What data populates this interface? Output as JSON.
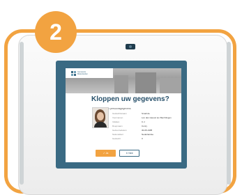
{
  "step": {
    "number": "2"
  },
  "screen": {
    "logo_text": [
      "Gemeente",
      "Molenlanden"
    ],
    "title": "Kloppen uw gegevens?",
    "subtitle": "Uw persoonsgegevens",
    "details": [
      {
        "label": "Geslachtsnaam",
        "value": "Smalt de"
      },
      {
        "label": "Voornamen",
        "value": "Lon den Heuvel ten Berchlingen"
      },
      {
        "label": "Initialen",
        "value": "C.J."
      },
      {
        "label": "Roepnaam",
        "value": "Conry"
      },
      {
        "label": "Geboortedatum",
        "value": "30-05-1985"
      },
      {
        "label": "Nationaliteit",
        "value": "Nederlandse"
      },
      {
        "label": "Geslacht",
        "value": "V"
      }
    ],
    "buttons": {
      "yes": "✓  Ja",
      "no": "✕  Nee"
    }
  },
  "colors": {
    "accent": "#f2a341",
    "bezel": "#3a6a83",
    "title": "#27506a"
  },
  "icons": [
    "camera-icon",
    "logo-icon",
    "check-icon",
    "close-icon"
  ]
}
